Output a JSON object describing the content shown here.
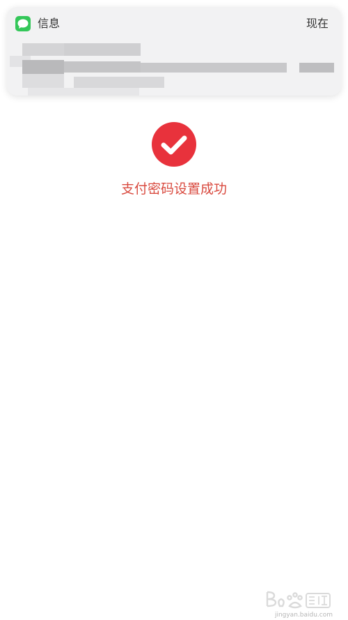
{
  "notification": {
    "app_icon": "messages-icon",
    "app_name": "信息",
    "time": "现在"
  },
  "success": {
    "icon": "checkmark-icon",
    "message": "支付密码设置成功",
    "accent_color": "#e8323c",
    "text_color": "#d94a3f"
  },
  "watermark": {
    "logo": "baidu-jingyan-logo",
    "url": "jingyan.baidu.com"
  }
}
